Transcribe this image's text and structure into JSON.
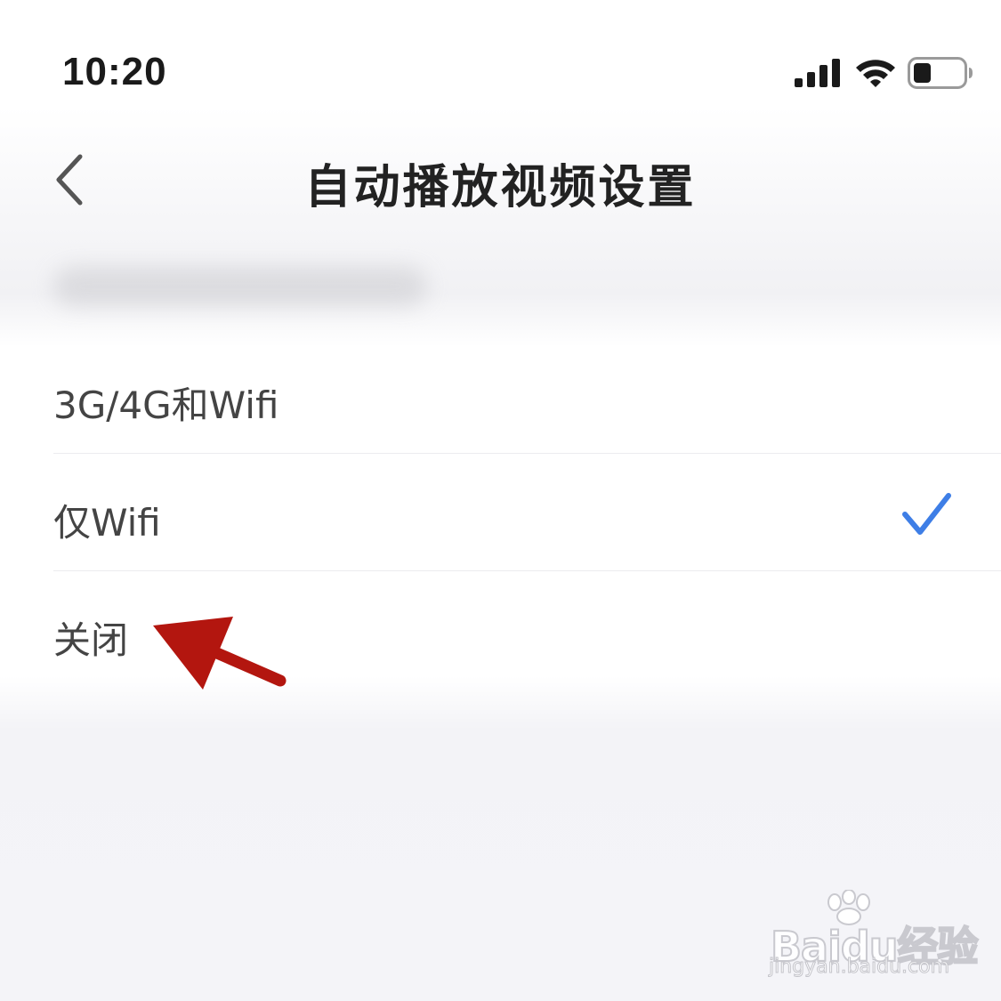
{
  "status_bar": {
    "time": "10:20",
    "icons": [
      "signal-icon",
      "wifi-icon",
      "battery-icon"
    ],
    "battery_level": 0.35
  },
  "header": {
    "back_icon": "chevron-left-icon",
    "title": "自动播放视频设置"
  },
  "options": [
    {
      "label": "3G/4G和Wifi",
      "selected": false
    },
    {
      "label": "仅Wifi",
      "selected": true
    },
    {
      "label": "关闭",
      "selected": false
    }
  ],
  "colors": {
    "accent": "#3e7ee6",
    "annotation_arrow": "#b3160f",
    "text_primary": "#222222",
    "text_option": "#444444"
  },
  "watermark": {
    "brand": "Baidu经验",
    "url": "jingyan.baidu.com"
  }
}
